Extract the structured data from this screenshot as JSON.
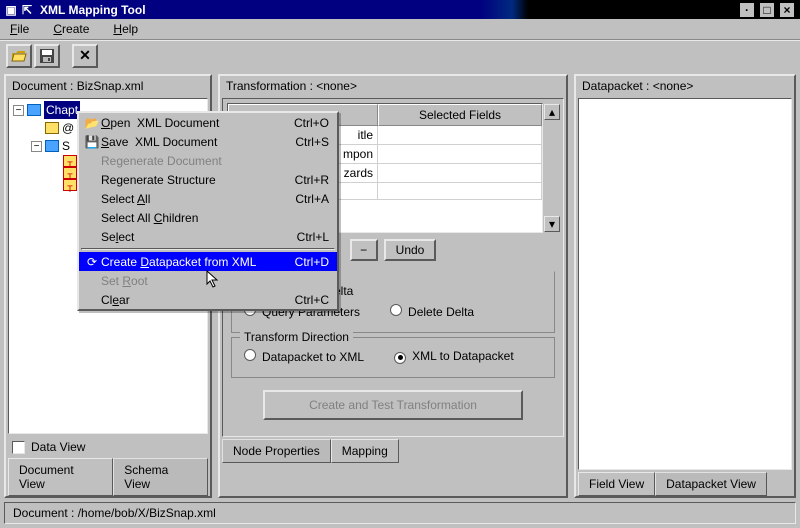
{
  "window": {
    "title": "XML Mapping Tool"
  },
  "menubar": {
    "file": "File",
    "create": "Create",
    "help": "Help"
  },
  "panels": {
    "left_title": "Document : BizSnap.xml",
    "mid_title": "Transformation : <none>",
    "right_title": "Datapacket : <none>"
  },
  "tree": {
    "n0": "Chapt",
    "n1": "@",
    "n2": "S",
    "n3_icon": "T",
    "n4_icon": "T",
    "n5_icon": "T"
  },
  "left_footer": {
    "dataview": "Data View"
  },
  "left_tabs": {
    "a": "Document View",
    "b": "Schema View"
  },
  "grid": {
    "col2": "Selected Fields",
    "r1c1": "itle",
    "r2c1": "mpon",
    "r3c1": "zards"
  },
  "gridbtns": {
    "minus": "−",
    "undo": "Undo"
  },
  "radios1": {
    "query": "Query Parameters",
    "insert": "Insert Delta",
    "delete": "Delete Delta"
  },
  "group_title": "Transform Direction",
  "radios2": {
    "d2x": "Datapacket to XML",
    "x2d": "XML to Datapacket"
  },
  "widebtn": "Create and Test Transformation",
  "mid_tabs": {
    "a": "Node Properties",
    "b": "Mapping"
  },
  "right_tabs": {
    "a": "Field View",
    "b": "Datapacket View"
  },
  "status": "Document : /home/bob/X/BizSnap.xml",
  "ctx": {
    "open": {
      "label": "Open  XML Document",
      "accel": "Ctrl+O"
    },
    "save": {
      "label": "Save  XML Document",
      "accel": "Ctrl+S"
    },
    "regen_d": {
      "label": "Regenerate Document",
      "accel": ""
    },
    "regen_s": {
      "label": "Regenerate Structure",
      "accel": "Ctrl+R"
    },
    "sel_all": {
      "label": "Select All",
      "accel": "Ctrl+A"
    },
    "sel_ch": {
      "label": "Select All Children",
      "accel": ""
    },
    "sel": {
      "label": "Select",
      "accel": "Ctrl+L"
    },
    "cdp": {
      "label": "Create Datapacket from XML",
      "accel": "Ctrl+D"
    },
    "setroot": {
      "label": "Set Root",
      "accel": ""
    },
    "clear": {
      "label": "Clear",
      "accel": "Ctrl+C"
    }
  }
}
